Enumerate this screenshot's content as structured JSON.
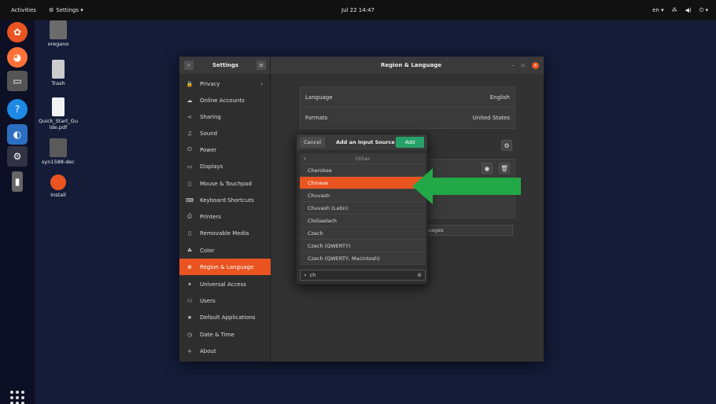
{
  "topbar": {
    "activities": "Activities",
    "app_menu": "Settings ▾",
    "clock": "Jul 22 14:47",
    "lang": "en ▾"
  },
  "desktop": [
    {
      "label": "oregano"
    },
    {
      "label": "Trash"
    },
    {
      "label": "Quick_Start_Gu ide.pdf"
    },
    {
      "label": "syn1588-dec"
    },
    {
      "label": "Install"
    }
  ],
  "settings": {
    "sidebar_title": "Settings",
    "title": "Region & Language",
    "sidebar": [
      {
        "label": "Privacy",
        "icon": "🔒"
      },
      {
        "label": "Online Accounts",
        "icon": "☁"
      },
      {
        "label": "Sharing",
        "icon": "<"
      },
      {
        "label": "Sound",
        "icon": "♫"
      },
      {
        "label": "Power",
        "icon": "⏻"
      },
      {
        "label": "Displays",
        "icon": "▭"
      },
      {
        "label": "Mouse & Touchpad",
        "icon": "▯"
      },
      {
        "label": "Keyboard Shortcuts",
        "icon": "⌨"
      },
      {
        "label": "Printers",
        "icon": "⎙"
      },
      {
        "label": "Removable Media",
        "icon": "▯"
      },
      {
        "label": "Color",
        "icon": "☘"
      },
      {
        "label": "Region & Language",
        "icon": "⊕"
      },
      {
        "label": "Universal Access",
        "icon": "✦"
      },
      {
        "label": "Users",
        "icon": "⚇"
      },
      {
        "label": "Default Applications",
        "icon": "★"
      },
      {
        "label": "Date & Time",
        "icon": "◷"
      },
      {
        "label": "About",
        "icon": "+"
      }
    ],
    "region": {
      "language_label": "Language",
      "language_value": "English",
      "formats_label": "Formats",
      "formats_value": "United States",
      "partial_button": "uages"
    }
  },
  "dialog": {
    "cancel": "Cancel",
    "title": "Add an Input Source",
    "add": "Add",
    "back_label": "Other",
    "items": [
      "Cherokee",
      "Chinese",
      "Chuvash",
      "Chuvash (Latin)",
      "CloGaelach",
      "Czech",
      "Czech (QWERTY)",
      "Czech (QWERTY, Macintosh)"
    ],
    "search_value": "ch"
  },
  "colors": {
    "accent": "#e95420",
    "add_button": "#26a269",
    "arrow": "#22a846"
  }
}
